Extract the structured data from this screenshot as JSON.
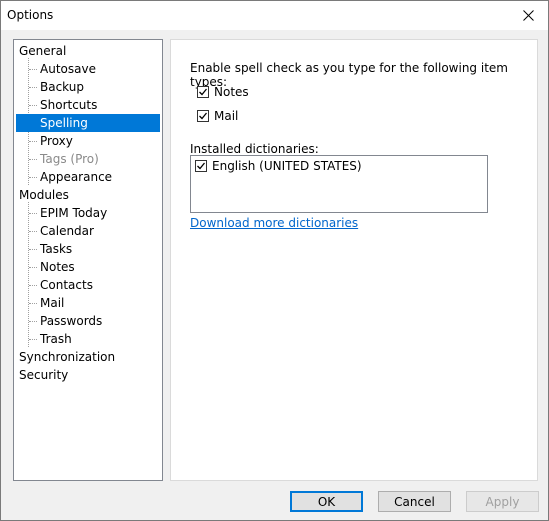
{
  "window": {
    "title": "Options"
  },
  "tree": {
    "items": [
      {
        "label": "General",
        "level": 0
      },
      {
        "label": "Autosave",
        "level": 1
      },
      {
        "label": "Backup",
        "level": 1
      },
      {
        "label": "Shortcuts",
        "level": 1
      },
      {
        "label": "Spelling",
        "level": 1,
        "selected": true
      },
      {
        "label": "Proxy",
        "level": 1
      },
      {
        "label": "Tags (Pro)",
        "level": 1,
        "disabled": true
      },
      {
        "label": "Appearance",
        "level": 1
      },
      {
        "label": "Modules",
        "level": 0
      },
      {
        "label": "EPIM Today",
        "level": 1
      },
      {
        "label": "Calendar",
        "level": 1
      },
      {
        "label": "Tasks",
        "level": 1
      },
      {
        "label": "Notes",
        "level": 1
      },
      {
        "label": "Contacts",
        "level": 1
      },
      {
        "label": "Mail",
        "level": 1
      },
      {
        "label": "Passwords",
        "level": 1
      },
      {
        "label": "Trash",
        "level": 1
      },
      {
        "label": "Synchronization",
        "level": 0
      },
      {
        "label": "Security",
        "level": 0
      }
    ]
  },
  "spelling": {
    "intro": "Enable spell check as you type for the following item types:",
    "types": [
      {
        "label": "Notes",
        "checked": true
      },
      {
        "label": "Mail",
        "checked": true
      }
    ],
    "dict_label": "Installed dictionaries:",
    "dictionaries": [
      {
        "label": "English (UNITED STATES)",
        "checked": true
      }
    ],
    "download_link": "Download more dictionaries"
  },
  "buttons": {
    "ok": "OK",
    "cancel": "Cancel",
    "apply": "Apply"
  },
  "colors": {
    "selection": "#0078d7",
    "link": "#0066cc"
  }
}
